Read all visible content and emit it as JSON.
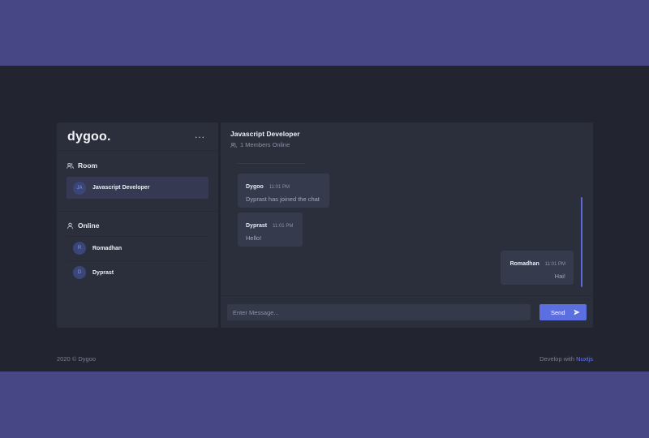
{
  "brand": {
    "logo": "dygoo."
  },
  "menu": {
    "label": "..."
  },
  "sidebar": {
    "room_section": {
      "title": "Room",
      "icon": "users-icon"
    },
    "rooms": [
      {
        "initials": "JA",
        "name": "Javascript Developer"
      }
    ],
    "online_section": {
      "title": "Online",
      "icon": "user-icon"
    },
    "users": [
      {
        "initials": "R",
        "name": "Romadhan"
      },
      {
        "initials": "D",
        "name": "Dyprast"
      }
    ]
  },
  "chat": {
    "title": "Javascript Developer",
    "members": "1 Members Online",
    "messages": [
      {
        "name": "Dygoo",
        "time": "11:01 PM",
        "text": "Dyprast has joined the chat"
      },
      {
        "name": "Dyprast",
        "time": "11:01 PM",
        "text": "Hello!"
      },
      {
        "name": "Romadhan",
        "time": "11:01 PM",
        "text": "Hai!"
      }
    ],
    "input": {
      "placeholder": "Enter Message...",
      "value": ""
    },
    "send_label": "Send"
  },
  "footer": {
    "copyright": "2020 © Dygoo",
    "develop_prefix": "Develop with",
    "develop_link": "Nuxtjs"
  },
  "colors": {
    "accent": "#5b6fe0",
    "header_band": "#474785",
    "background": "#22252f",
    "panel": "#2b2e3b"
  }
}
